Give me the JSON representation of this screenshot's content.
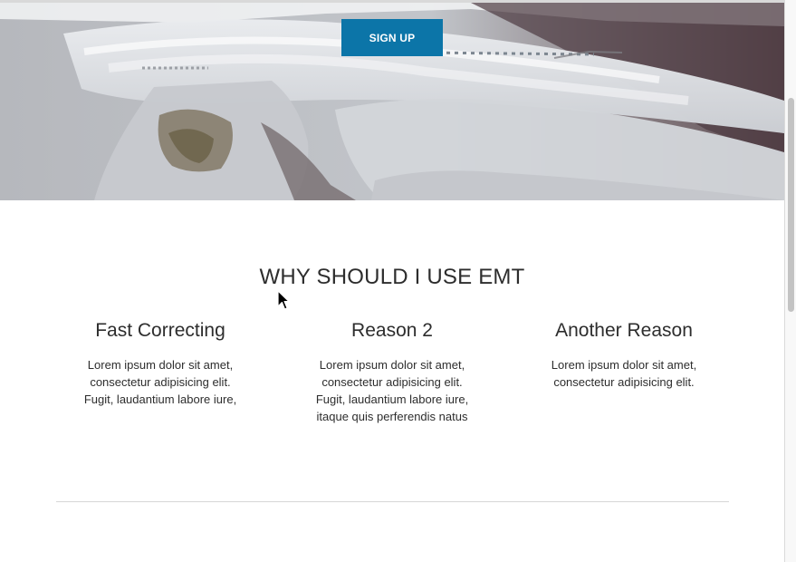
{
  "hero": {
    "cta_label": "SIGN UP"
  },
  "reasons_section": {
    "title": "WHY SHOULD I USE EMT",
    "items": [
      {
        "title": "Fast Correcting",
        "lines": [
          "Lorem ipsum dolor sit amet,",
          "consectetur adipisicing elit.",
          "Fugit, laudantium labore iure,"
        ]
      },
      {
        "title": "Reason 2",
        "lines": [
          "Lorem ipsum dolor sit amet,",
          "consectetur adipisicing elit.",
          "Fugit, laudantium labore iure,",
          "itaque quis perferendis natus"
        ]
      },
      {
        "title": "Another Reason",
        "lines": [
          "Lorem ipsum dolor sit amet,",
          "consectetur adipisicing elit."
        ]
      }
    ]
  },
  "colors": {
    "button": "#0c75a8",
    "heading": "#2d2d2d",
    "divider": "#d6d6d6"
  },
  "icons": {
    "cursor": "mouse-pointer-icon"
  }
}
